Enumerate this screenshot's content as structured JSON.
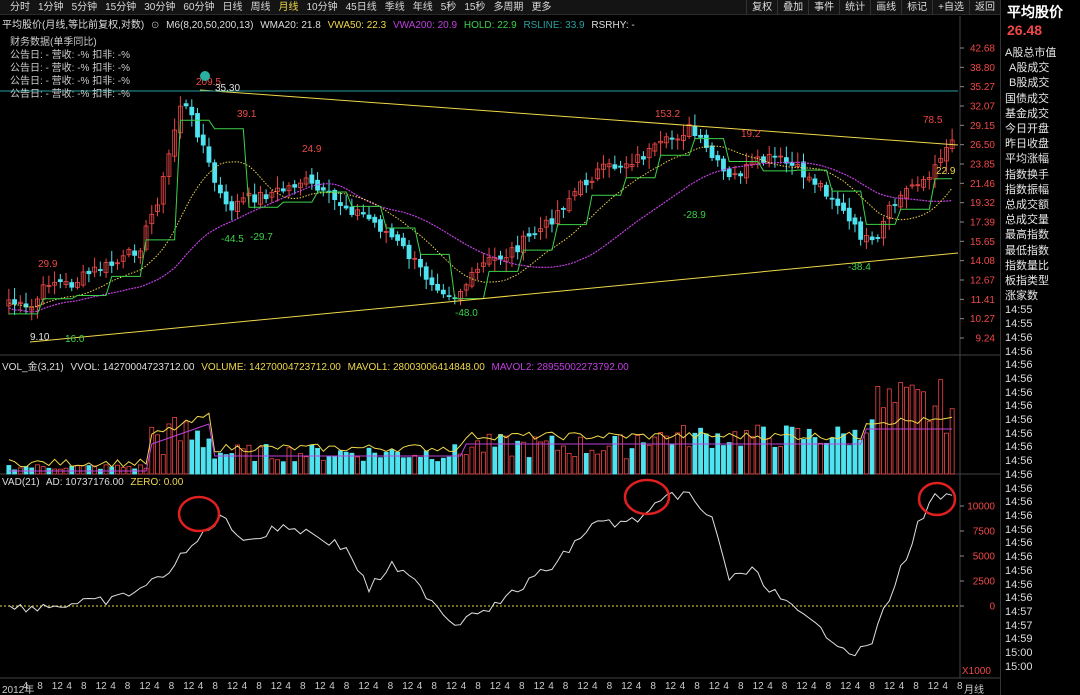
{
  "period_tabs": [
    "分时",
    "1分钟",
    "5分钟",
    "15分钟",
    "30分钟",
    "60分钟",
    "日线",
    "周线",
    "月线",
    "10分钟",
    "45日线",
    "季线",
    "年线",
    "5秒",
    "15秒",
    "多周期",
    "更多"
  ],
  "active_period": "月线",
  "tool_tabs": [
    "复权",
    "叠加",
    "事件",
    "统计",
    "画线",
    "标记",
    "+自选",
    "返回"
  ],
  "right_panel": {
    "title": "平均股价",
    "price": "26.48",
    "items": [
      "A股总市值",
      "A股成交",
      "B股成交",
      "国债成交",
      "基金成交",
      "今日开盘",
      "昨日收盘",
      "平均涨幅",
      "指数换手",
      "指数振幅",
      "总成交额",
      "总成交量",
      "最高指数",
      "最低指数",
      "指数量比",
      "板指类型",
      "涨家数"
    ],
    "times": [
      "14:55",
      "14:55",
      "14:56",
      "14:56",
      "14:56",
      "14:56",
      "14:56",
      "14:56",
      "14:56",
      "14:56",
      "14:56",
      "14:56",
      "14:56",
      "14:56",
      "14:56",
      "14:56",
      "14:56",
      "14:56",
      "14:56",
      "14:56",
      "14:56",
      "14:56",
      "14:57",
      "14:57",
      "14:59",
      "15:00",
      "15:00"
    ]
  },
  "main_legend": {
    "name": "平均股价(月线,等比前复权,对数)",
    "m6": "M6(8,20,50,200,13)",
    "wma20": "WMA20: 21.8",
    "vwa50": "VWA50: 22.3",
    "vwa200": "VWA200: 20.9",
    "hold": "HOLD: 22.9",
    "rsline": "RSLINE: 33.9",
    "rsrhy": "RSRHY: -"
  },
  "financial": {
    "title": "财务数据(单季同比)",
    "rows": [
      "公告日: -   营收: -%   扣非: -%",
      "公告日: -   营收: -%   扣非: -%",
      "公告日: -   营收: -%   扣非: -%",
      "公告日: -   营收: -%   扣非: -%"
    ]
  },
  "price_axis": [
    "42.68",
    "38.80",
    "35.27",
    "32.07",
    "29.15",
    "26.50",
    "23.85",
    "21.46",
    "19.32",
    "17.39",
    "15.65",
    "14.08",
    "12.67",
    "11.41",
    "10.27",
    "9.24"
  ],
  "annotations": [
    "9.10",
    "16.0",
    "29.9",
    "209.5",
    "35.30",
    "39.1",
    "-44.5",
    "-29.7",
    "24.9",
    "-48.0",
    "153.2",
    "-28.9",
    "19.2",
    "-38.4",
    "78.5",
    "22.9"
  ],
  "vol_legend": {
    "name": "VOL_金(3,21)",
    "vvol": "VVOL: 14270004723712.00",
    "volume": "VOLUME: 14270004723712.00",
    "mavol1": "MAVOL1: 28003006414848.00",
    "mavol2": "MAVOL2: 28955002273792.00"
  },
  "vad_legend": {
    "name": "VAD(21)",
    "ad": "AD: 10737176.00",
    "zero": "ZERO: 0.00"
  },
  "vad_axis": [
    "10000",
    "7500",
    "5000",
    "2500",
    "0"
  ],
  "vad_unit": "X1000",
  "x_ticks": [
    "2012年",
    "4",
    "8",
    "12",
    "4",
    "8",
    "12",
    "4",
    "8",
    "12",
    "4",
    "8",
    "12",
    "4",
    "8",
    "12",
    "4",
    "8",
    "12",
    "4",
    "8",
    "12",
    "4",
    "8",
    "12",
    "4",
    "8",
    "12",
    "4",
    "8",
    "12",
    "4",
    "8",
    "12",
    "4",
    "8",
    "12",
    "4",
    "8",
    "12",
    "4",
    "8",
    "12",
    "4",
    "8",
    "12",
    "4",
    "8",
    "12",
    "4",
    "8",
    "12",
    "4",
    "8",
    "12",
    "4",
    "8",
    "12",
    "4",
    "8",
    "12",
    "4",
    "8",
    "12",
    "4",
    "8"
  ],
  "period_label": "月线",
  "colors": {
    "up": "#f04848",
    "down": "#4fe3f0",
    "yellow": "#f0d84a",
    "green": "#3cd24a",
    "purple": "#c040e0",
    "white": "#e0e0e0",
    "cyan_line": "#2aa0a0"
  }
}
